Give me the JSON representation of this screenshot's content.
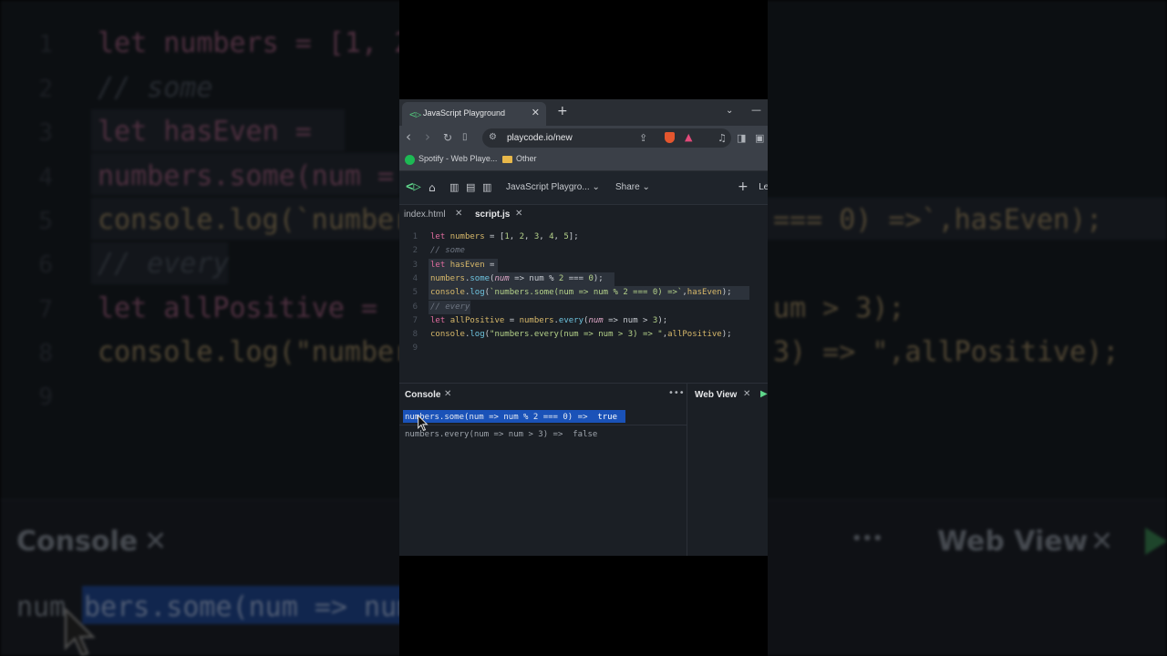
{
  "background_zoom": {
    "line_numbers": [
      "1",
      "2",
      "3",
      "4",
      "5",
      "6",
      "7",
      "8",
      "9"
    ],
    "code_fragments": {
      "l1": "let numbers = [1, 2",
      "l2": "// some",
      "l3": "let hasEven =",
      "l4": "numbers.some(num =",
      "l5": "console.log(`number",
      "l5_right": "=== 0) =>`,hasEven);",
      "l6": "// every",
      "l7": "let allPositive =",
      "l7_right": "um > 3);",
      "l8": "console.log(\"number",
      "l8_right": "3) => \",allPositive);"
    },
    "console_title": "Console",
    "console_close": "✕",
    "console_dots": "•••",
    "webview_title": "Web View",
    "webview_close": "✕",
    "output_fragment_a": "num",
    "output_fragment_b": "bers.some(num => num"
  },
  "browser": {
    "tab_title": "JavaScript Playground",
    "tab_close": "✕",
    "new_tab": "+",
    "tab_menu": "⌄",
    "minimize": "—",
    "nav_back": "‹",
    "nav_forward": "›",
    "reload": "↻",
    "bookmark": "🔖",
    "url": "playcode.io/new",
    "bookmarks": {
      "spotify": "Spotify - Web Playe...",
      "other": "Other"
    }
  },
  "app": {
    "logo": "▷",
    "project_name": "JavaScript Playgro...",
    "project_caret": "⌄",
    "share_label": "Share",
    "share_caret": "⌄",
    "add": "+",
    "login_partial": "Le",
    "file_tabs": [
      {
        "label": "index.html",
        "close": "✕"
      },
      {
        "label": "script.js",
        "close": "✕"
      }
    ],
    "editor_lines": [
      "1",
      "2",
      "3",
      "4",
      "5",
      "6",
      "7",
      "8",
      "9"
    ],
    "console": {
      "title": "Console",
      "close": "✕",
      "menu": "•••",
      "outputs": [
        {
          "text": "numbers.some(num => num % 2 === 0) => ",
          "value": "true"
        },
        {
          "text": "numbers.every(num => num > 3) => ",
          "value": "false"
        }
      ]
    },
    "webview": {
      "title": "Web View",
      "close": "✕",
      "run": "▶"
    }
  },
  "colors": {
    "accent_green": "#5fd68b",
    "selection_blue": "#1a52b8",
    "keyword": "#e06c9f",
    "variable": "#d7b86a",
    "function": "#6ec3de"
  }
}
